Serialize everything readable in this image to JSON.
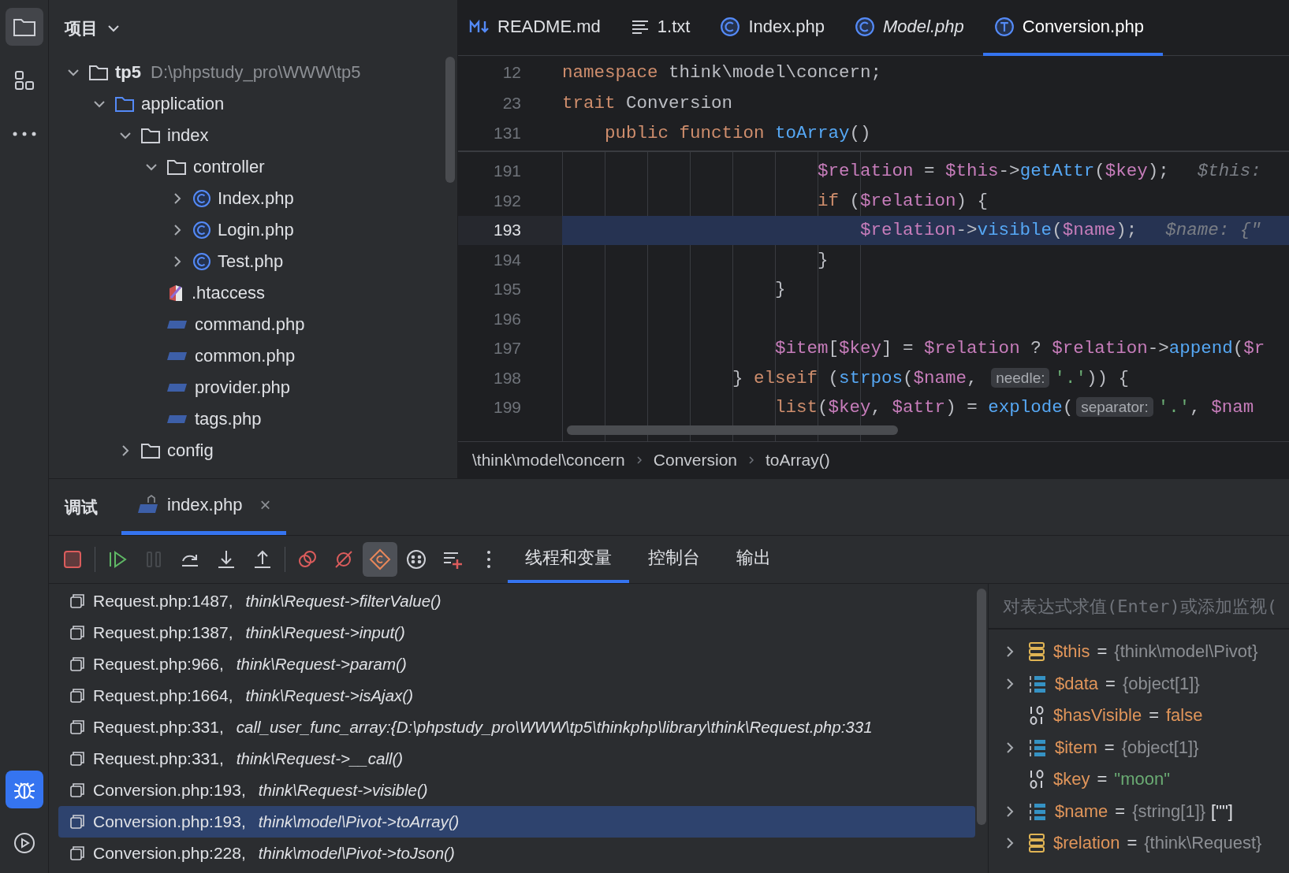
{
  "activity_bar": {
    "top": [
      {
        "kind": "folder",
        "selected": true
      },
      {
        "kind": "structure",
        "selected": false
      },
      {
        "kind": "more",
        "selected": false
      }
    ],
    "bottom": [
      {
        "kind": "debug",
        "selected": true
      },
      {
        "kind": "run",
        "selected": false
      }
    ]
  },
  "project": {
    "title": "项目",
    "tree": [
      {
        "label": "tp5",
        "kind": "root",
        "path": "D:\\phpstudy_pro\\WWW\\tp5",
        "expanded": true,
        "children": [
          {
            "label": "application",
            "kind": "folder",
            "expanded": true,
            "children": [
              {
                "label": "index",
                "kind": "folder",
                "expanded": true,
                "children": [
                  {
                    "label": "controller",
                    "kind": "folder",
                    "expanded": true,
                    "children": [
                      {
                        "label": "Index.php",
                        "kind": "class",
                        "expanded": false
                      },
                      {
                        "label": "Login.php",
                        "kind": "class",
                        "expanded": false
                      },
                      {
                        "label": "Test.php",
                        "kind": "class",
                        "expanded": false
                      }
                    ]
                  },
                  {
                    "label": ".htaccess",
                    "kind": "htaccess"
                  },
                  {
                    "label": "command.php",
                    "kind": "php"
                  },
                  {
                    "label": "common.php",
                    "kind": "php"
                  },
                  {
                    "label": "provider.php",
                    "kind": "php"
                  },
                  {
                    "label": "tags.php",
                    "kind": "php"
                  }
                ]
              },
              {
                "label": "config",
                "kind": "folder",
                "expanded": false
              }
            ]
          }
        ]
      }
    ]
  },
  "editor": {
    "tabs": [
      {
        "label": "README.md",
        "kind": "markdown",
        "selected": false,
        "preview": false
      },
      {
        "label": "1.txt",
        "kind": "text",
        "selected": false,
        "preview": false
      },
      {
        "label": "Index.php",
        "kind": "class",
        "selected": false,
        "preview": false
      },
      {
        "label": "Model.php",
        "kind": "class",
        "selected": false,
        "preview": true
      },
      {
        "label": "Conversion.php",
        "kind": "trait",
        "selected": true,
        "preview": false
      }
    ],
    "sticky_lines": [
      {
        "number": "12",
        "tokens": [
          {
            "kind": "kw",
            "text": "namespace"
          },
          {
            "kind": "plain",
            "text": " think\\model\\concern;"
          }
        ]
      },
      {
        "number": "23",
        "tokens": [
          {
            "kind": "kw",
            "text": "trait"
          },
          {
            "kind": "plain",
            "text": " Conversion"
          }
        ]
      },
      {
        "number": "131",
        "tokens": [
          {
            "kind": "kw",
            "text": "    public function"
          },
          {
            "kind": "fn",
            "text": " toArray"
          },
          {
            "kind": "plain",
            "text": "()"
          }
        ]
      }
    ],
    "lines": [
      {
        "number": "191",
        "current": false,
        "tokens": [
          {
            "kind": "var",
            "text": "                        $relation"
          },
          {
            "kind": "plain",
            "text": " = "
          },
          {
            "kind": "var",
            "text": "$this"
          },
          {
            "kind": "plain",
            "text": "->"
          },
          {
            "kind": "fn",
            "text": "getAttr"
          },
          {
            "kind": "plain",
            "text": "("
          },
          {
            "kind": "var",
            "text": "$key"
          },
          {
            "kind": "plain",
            "text": ");"
          },
          {
            "kind": "hint",
            "text": "$this:"
          }
        ]
      },
      {
        "number": "192",
        "current": false,
        "tokens": [
          {
            "kind": "kw",
            "text": "                        if"
          },
          {
            "kind": "plain",
            "text": " ("
          },
          {
            "kind": "var",
            "text": "$relation"
          },
          {
            "kind": "plain",
            "text": ") {"
          }
        ]
      },
      {
        "number": "193",
        "current": true,
        "tokens": [
          {
            "kind": "var",
            "text": "                            $relation"
          },
          {
            "kind": "plain",
            "text": "->"
          },
          {
            "kind": "fn",
            "text": "visible"
          },
          {
            "kind": "plain",
            "text": "("
          },
          {
            "kind": "var",
            "text": "$name"
          },
          {
            "kind": "plain",
            "text": ");"
          },
          {
            "kind": "hint",
            "text": "$name: {\""
          }
        ]
      },
      {
        "number": "194",
        "current": false,
        "tokens": [
          {
            "kind": "plain",
            "text": "                        }"
          }
        ]
      },
      {
        "number": "195",
        "current": false,
        "tokens": [
          {
            "kind": "plain",
            "text": "                    }"
          }
        ]
      },
      {
        "number": "196",
        "current": false
      },
      {
        "number": "197",
        "current": false,
        "tokens": [
          {
            "kind": "var",
            "text": "                    $item"
          },
          {
            "kind": "plain",
            "text": "["
          },
          {
            "kind": "var",
            "text": "$key"
          },
          {
            "kind": "plain",
            "text": "] = "
          },
          {
            "kind": "var",
            "text": "$relation"
          },
          {
            "kind": "plain",
            "text": " ? "
          },
          {
            "kind": "var",
            "text": "$relation"
          },
          {
            "kind": "plain",
            "text": "->"
          },
          {
            "kind": "fn",
            "text": "append"
          },
          {
            "kind": "plain",
            "text": "("
          },
          {
            "kind": "var",
            "text": "$r"
          }
        ]
      },
      {
        "number": "198",
        "current": false,
        "tokens": [
          {
            "kind": "plain",
            "text": "                } "
          },
          {
            "kind": "kw",
            "text": "elseif"
          },
          {
            "kind": "plain",
            "text": " ("
          },
          {
            "kind": "fn",
            "text": "strpos"
          },
          {
            "kind": "plain",
            "text": "("
          },
          {
            "kind": "var",
            "text": "$name"
          },
          {
            "kind": "plain",
            "text": ", "
          },
          {
            "kind": "param",
            "text": "needle:"
          },
          {
            "kind": "str",
            "text": "'.'"
          },
          {
            "kind": "plain",
            "text": ")) {"
          }
        ]
      },
      {
        "number": "199",
        "current": false,
        "tokens": [
          {
            "kind": "kw",
            "text": "                    list"
          },
          {
            "kind": "plain",
            "text": "("
          },
          {
            "kind": "var",
            "text": "$key"
          },
          {
            "kind": "plain",
            "text": ", "
          },
          {
            "kind": "var",
            "text": "$attr"
          },
          {
            "kind": "plain",
            "text": ") = "
          },
          {
            "kind": "fn",
            "text": "explode"
          },
          {
            "kind": "plain",
            "text": "("
          },
          {
            "kind": "param",
            "text": "separator:"
          },
          {
            "kind": "str",
            "text": "'.'"
          },
          {
            "kind": "plain",
            "text": ", "
          },
          {
            "kind": "var",
            "text": "$nam"
          }
        ]
      }
    ],
    "breadcrumbs": [
      "\\think\\model\\concern",
      "Conversion",
      "toArray()"
    ]
  },
  "debug": {
    "title": "调试",
    "tabs": [
      {
        "label": "index.php",
        "selected": true,
        "close": "×"
      }
    ],
    "toolbar": [
      {
        "kind": "stop",
        "disabled": false,
        "on": false
      },
      {
        "kind": "resume",
        "disabled": false,
        "on": false
      },
      {
        "kind": "pause",
        "disabled": true,
        "on": false
      },
      {
        "kind": "step-over",
        "disabled": false,
        "on": false
      },
      {
        "kind": "step-into",
        "disabled": false,
        "on": false
      },
      {
        "kind": "step-out",
        "disabled": false,
        "on": false
      },
      {
        "kind": "breakpoints",
        "disabled": false,
        "on": false
      },
      {
        "kind": "mute",
        "disabled": false,
        "on": false
      },
      {
        "kind": "class-filter",
        "disabled": false,
        "on": true
      },
      {
        "kind": "threads",
        "disabled": false,
        "on": false
      },
      {
        "kind": "add-watch",
        "disabled": false,
        "on": false
      },
      {
        "kind": "more",
        "disabled": false,
        "on": false
      }
    ],
    "panel_tabs": [
      {
        "label": "线程和变量",
        "selected": true
      },
      {
        "label": "控制台",
        "selected": false
      },
      {
        "label": "输出",
        "selected": false
      }
    ],
    "frames": [
      {
        "file": "Request.php:1487,",
        "method": "think\\Request->filterValue()",
        "selected": false
      },
      {
        "file": "Request.php:1387,",
        "method": "think\\Request->input()",
        "selected": false
      },
      {
        "file": "Request.php:966,",
        "method": "think\\Request->param()",
        "selected": false
      },
      {
        "file": "Request.php:1664,",
        "method": "think\\Request->isAjax()",
        "selected": false
      },
      {
        "file": "Request.php:331,",
        "method": "call_user_func_array:{D:\\phpstudy_pro\\WWW\\tp5\\thinkphp\\library\\think\\Request.php:331",
        "selected": false
      },
      {
        "file": "Request.php:331,",
        "method": "think\\Request->__call()",
        "selected": false
      },
      {
        "file": "Conversion.php:193,",
        "method": "think\\Request->visible()",
        "selected": false
      },
      {
        "file": "Conversion.php:193,",
        "method": "think\\model\\Pivot->toArray()",
        "selected": true
      },
      {
        "file": "Conversion.php:228,",
        "method": "think\\model\\Pivot->toJson()",
        "selected": false
      }
    ],
    "evaluate": {
      "placeholder": "对表达式求值(Enter)或添加监视("
    },
    "variables": [
      {
        "name": "$this",
        "op": "=",
        "value": "{think\\model\\Pivot}",
        "kind": "object",
        "expandable": true
      },
      {
        "name": "$data",
        "op": "=",
        "value": "{object[1]}",
        "kind": "array",
        "expandable": true
      },
      {
        "name": "$hasVisible",
        "op": "=",
        "value": "false",
        "kind": "bool",
        "expandable": false
      },
      {
        "name": "$item",
        "op": "=",
        "value": "{object[1]}",
        "kind": "array",
        "expandable": true
      },
      {
        "name": "$key",
        "op": "=",
        "value": "\"moon\"",
        "kind": "string",
        "expandable": false
      },
      {
        "name": "$name",
        "op": "=",
        "value": "{string[1]}",
        "extra": "[\"\"]",
        "kind": "array",
        "expandable": true
      },
      {
        "name": "$relation",
        "op": "=",
        "value": "{think\\Request}",
        "kind": "object",
        "expandable": true
      }
    ]
  }
}
